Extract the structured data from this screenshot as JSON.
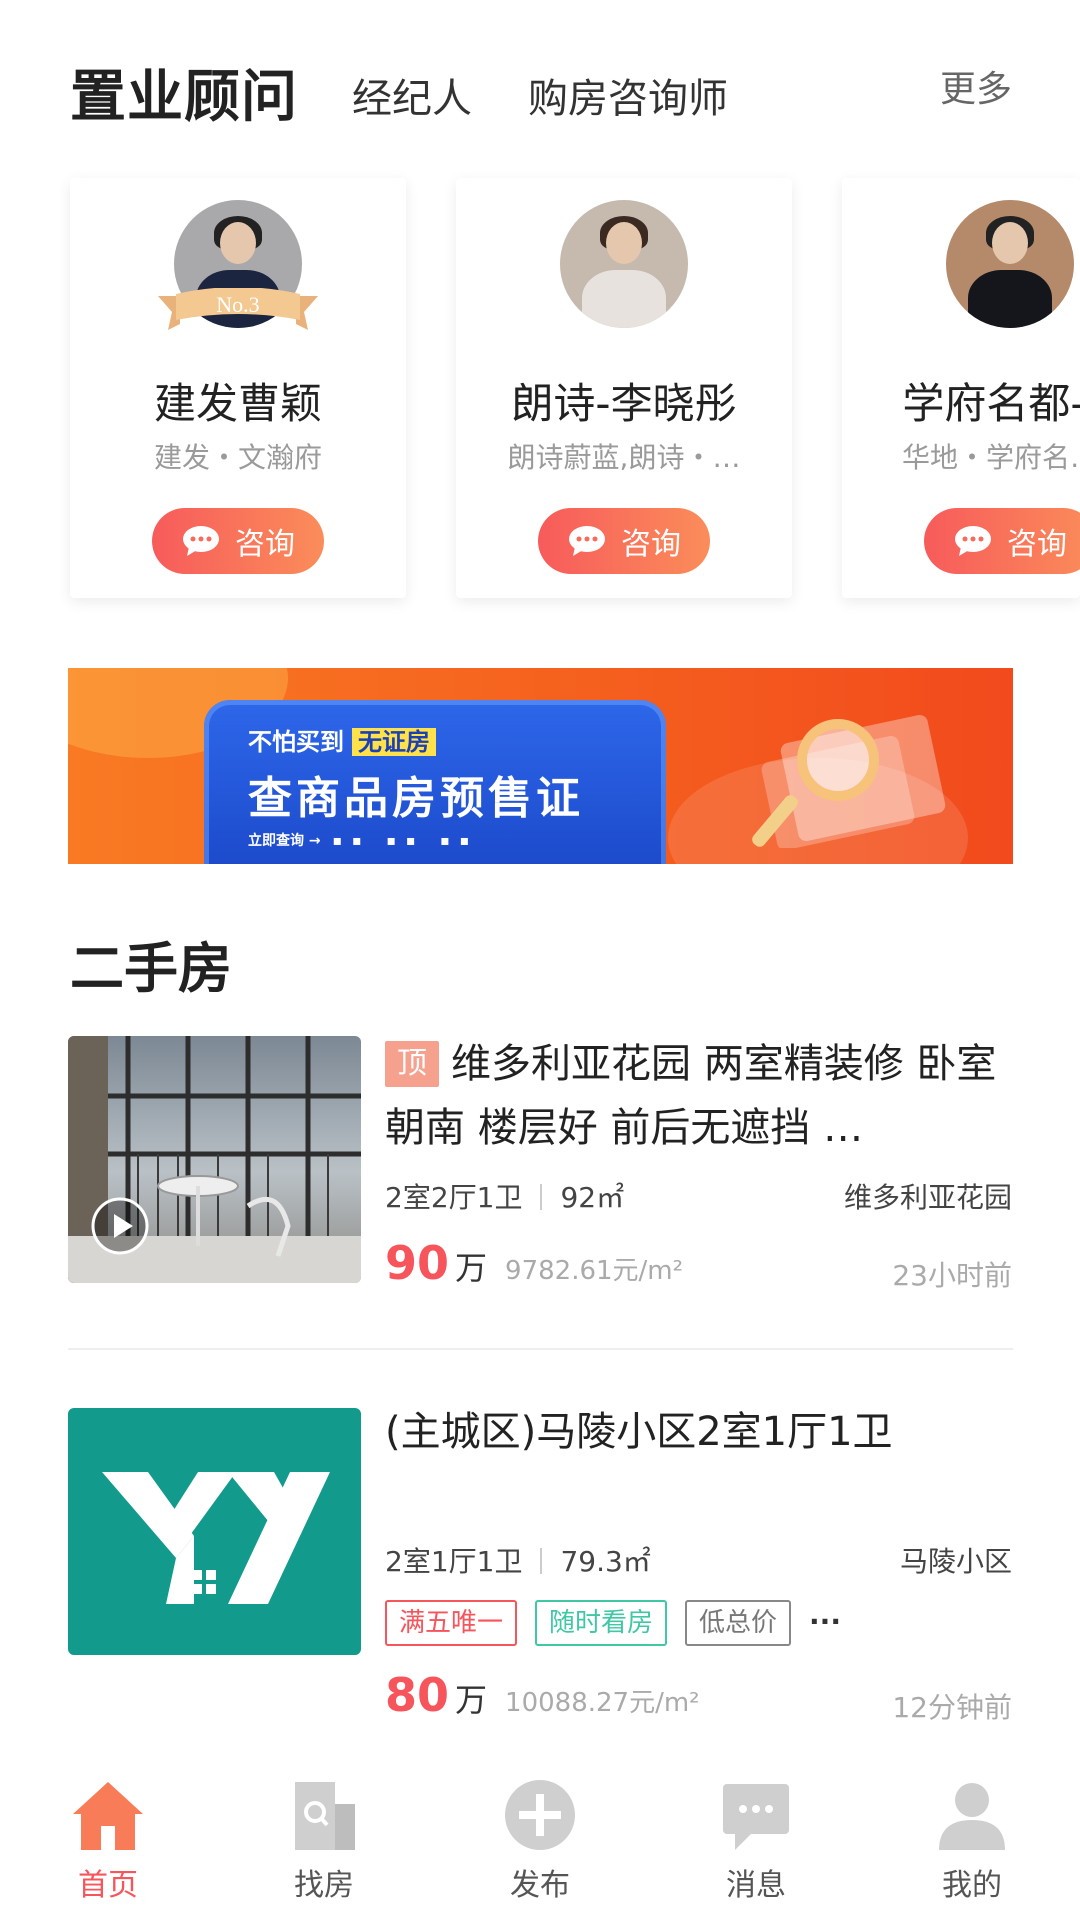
{
  "advisors_section": {
    "title": "置业顾问",
    "tabs": [
      "经纪人",
      "购房咨询师"
    ],
    "more": "更多"
  },
  "advisors": [
    {
      "name": "建发曹颖",
      "project": "建发・文瀚府",
      "rank_badge": "No.3",
      "button": "咨询"
    },
    {
      "name": "朗诗-李晓彤",
      "project": "朗诗蔚蓝,朗诗・…",
      "button": "咨询"
    },
    {
      "name": "学府名都-…",
      "project": "华地・学府名…",
      "button": "咨询"
    }
  ],
  "banner": {
    "line1": "不怕买到",
    "line1_tag": "无证房",
    "line2": "查商品房预售证",
    "line3": "立即查询 →"
  },
  "listings_section": {
    "title": "二手房"
  },
  "listings": [
    {
      "top_badge": "顶",
      "title": "维多利亚花园 两室精装修 卧室朝南 楼层好 前后无遮挡 …",
      "layout": "2室2厅1卫",
      "area": "92㎡",
      "community": "维多利亚花园",
      "price": "90",
      "price_unit": "万",
      "unit_price": "9782.61元/m²",
      "time": "23小时前",
      "has_video": true
    },
    {
      "title": "(主城区)马陵小区2室1厅1卫",
      "layout": "2室1厅1卫",
      "area": "79.3㎡",
      "community": "马陵小区",
      "tags": [
        "满五唯一",
        "随时看房",
        "低总价"
      ],
      "more": "···",
      "price": "80",
      "price_unit": "万",
      "unit_price": "10088.27元/m²",
      "time": "12分钟前"
    }
  ],
  "bottom_nav": [
    {
      "label": "首页",
      "icon": "home-icon",
      "active": true
    },
    {
      "label": "找房",
      "icon": "building-search-icon"
    },
    {
      "label": "发布",
      "icon": "plus-circle-icon"
    },
    {
      "label": "消息",
      "icon": "message-icon"
    },
    {
      "label": "我的",
      "icon": "user-icon"
    }
  ],
  "colors": {
    "accent": "#f5555b",
    "button_gradient_start": "#f75b5b",
    "button_gradient_end": "#fb8d5a",
    "tag_red": "#f5555b",
    "tag_green": "#3fc7a6",
    "tag_gray": "#888888",
    "logo_bg": "#129a8c"
  }
}
